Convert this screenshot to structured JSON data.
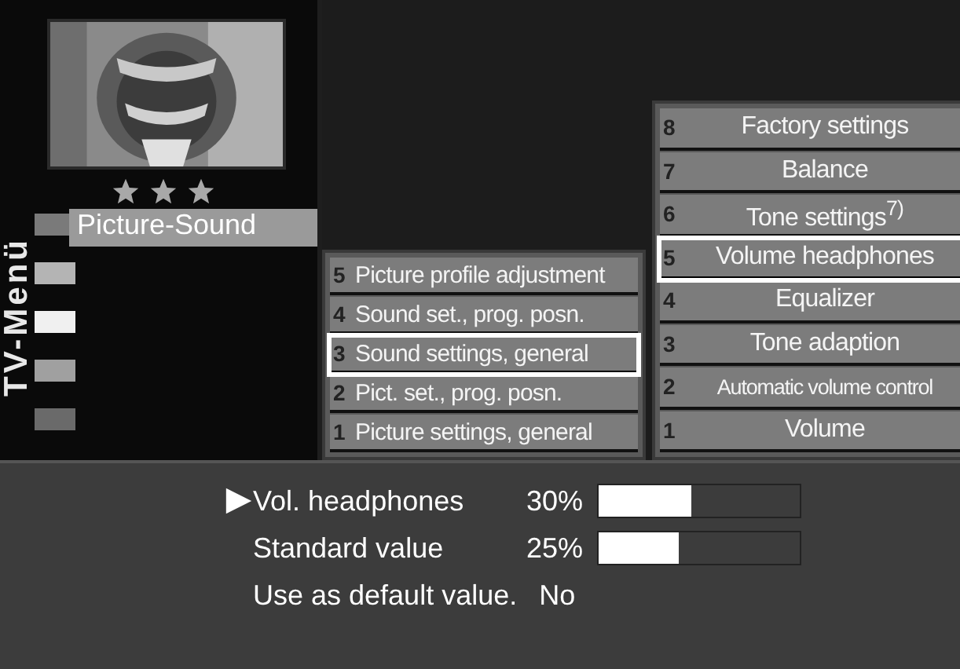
{
  "side_panel": {
    "stars": 3,
    "vertical_title": "TV-Menü",
    "title": "Picture-Sound",
    "squares": [
      {
        "color": "#7a7a7a"
      },
      {
        "color": "#b4b4b4"
      },
      {
        "color": "#f0f0f0"
      },
      {
        "color": "#a0a0a0"
      },
      {
        "color": "#6a6a6a"
      }
    ]
  },
  "menu_level_2": [
    {
      "number": "5",
      "label": "Picture profile adjustment",
      "selected": false
    },
    {
      "number": "4",
      "label": "Sound set., prog. posn.",
      "selected": false
    },
    {
      "number": "3",
      "label": "Sound settings, general",
      "selected": true
    },
    {
      "number": "2",
      "label": "Pict. set., prog. posn.",
      "selected": false
    },
    {
      "number": "1",
      "label": "Picture settings, general",
      "selected": false
    }
  ],
  "menu_level_3": [
    {
      "number": "8",
      "label": "Factory settings",
      "selected": false
    },
    {
      "number": "7",
      "label": "Balance",
      "selected": false
    },
    {
      "number": "6",
      "label": "Tone settings$^{7)}$",
      "selected": false
    },
    {
      "number": "5",
      "label": "Volume headphones",
      "selected": true
    },
    {
      "number": "4",
      "label": "Equalizer",
      "selected": false
    },
    {
      "number": "3",
      "label": "Tone adaption",
      "selected": false
    },
    {
      "number": "2",
      "label": "Automatic volume control",
      "selected": false
    },
    {
      "number": "1",
      "label": "Volume",
      "selected": false
    }
  ],
  "settings": [
    {
      "kind": "bar",
      "label": "Vol. headphones",
      "value": "30%",
      "level": 0.46,
      "selected": true
    },
    {
      "kind": "bar",
      "label": "Standard value",
      "value": "25%",
      "level": 0.4,
      "selected": false
    },
    {
      "kind": "choice",
      "label": "Use as default value.",
      "value": "No",
      "selected": false
    }
  ]
}
